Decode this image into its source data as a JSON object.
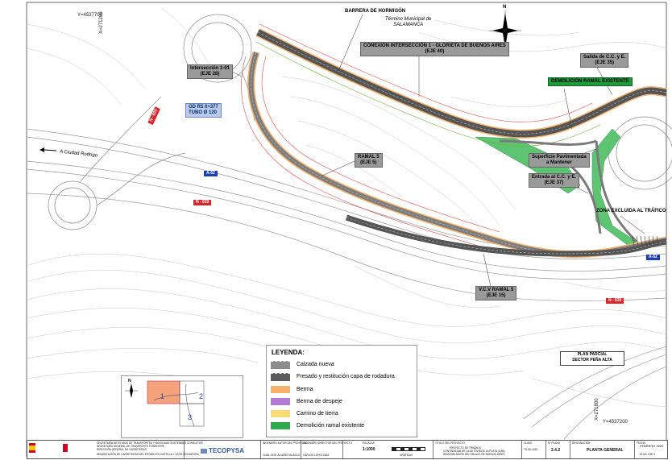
{
  "labels": {
    "barrera": "BARRERA DE HORMIGÓN",
    "termino_1": "Término Municipal de",
    "termino_2": "SALAMANCA",
    "conexion_1": "CONEXIÓN INTERSECCIÓN 1 - GLORIETA DE BUENOS AIRES",
    "conexion_2": "(EJE 40)",
    "salida_1": "Salida de C.C. y E.",
    "salida_2": "(EJE 35)",
    "demolicion": "DEMOLICIÓN RAMAL EXISTENTE",
    "interseccion_1": "Intersección 1-01",
    "interseccion_2": "(EJE 28)",
    "od_1": "OD R5 0+377",
    "od_2": "TUBO Ø 120",
    "ramal_1": "RAMAL 5",
    "ramal_2": "(EJE 5)",
    "superficie_1": "Superficie Pavimentada",
    "superficie_2": "a Mantener",
    "entrada_1": "Entrada al C.C. y E.",
    "entrada_2": "(EJE 37)",
    "zona": "ZONA EXCLUIDA AL TRÁFICO",
    "vcv_1": "V.C.V RAMAL 5",
    "vcv_2": "(EJE 15)",
    "ciudad": "A Ciudad Rodrigo",
    "plan_1": "PLAN PARCIAL",
    "plan_2": "SECTOR PEÑA ALTA",
    "north": "N"
  },
  "roads": {
    "n620_a": "N - 620",
    "n620_b": "N - 620",
    "n620_c": "N - 620",
    "a62_a": "A-62",
    "a62_b": "A-62"
  },
  "coords": {
    "y_top": "Y=4537700",
    "x_top": "X=271200",
    "y_bottom": "Y=4537200",
    "x_bottom": "X=271800"
  },
  "legend": {
    "title": "LEYENDA:",
    "items": [
      {
        "label": "Calzada nueva",
        "color": "#8c8c8c"
      },
      {
        "label": "Fresado y restitución capa de rodadura",
        "color": "#5a5a5a"
      },
      {
        "label": "Berma",
        "color": "#f6b26b"
      },
      {
        "label": "Berma de despeje",
        "color": "#b57bd6"
      },
      {
        "label": "Camino de tierra",
        "color": "#f7dc74"
      },
      {
        "label": "Demolición ramal existente",
        "color": "#2faa4f"
      }
    ]
  },
  "keymap": {
    "n1": "1",
    "n2": "2",
    "n3": "3",
    "north": "N"
  },
  "titleblock": {
    "ministry": "SECRETARÍA DE ESTADO DE TRANSPORTES Y MOVILIDAD SOSTENIBLE",
    "ministry_2": "SECRETARÍA GENERAL DE TRANSPORTE TERRESTRE",
    "ministry_3": "DIRECCIÓN GENERAL DE CARRETERAS",
    "ministry_4": "DEMARCACIÓN DE CARRETERAS DEL ESTADO EN CASTILLA Y LEÓN OCCIDENTAL",
    "consultor": "CONSULTOR",
    "company": "TECOPYSA",
    "autor": "INGENIERO AUTOR DEL PROYECTO",
    "autor_name": "JUAN JOSÉ ÁLVAREZ BLASCO",
    "director": "INGENIERO DIRECTOR DEL PROYECTO",
    "director_name": "CARLOS LÓPEZ DÍAZ",
    "escala_label": "ESCALAS",
    "escala": "1:1000",
    "graficas": "GRÁFICAS",
    "titulo_label": "TÍTULO DEL PROYECTO",
    "titulo_1": "PROYECTO DE TRAZADO",
    "titulo_2": "CONTINUIDAD DE LA AUTOVÍA DE LA PLATA (A-66)",
    "titulo_3": "REMODELACIÓN DEL ENLACE DE BUENOS AIRES",
    "clave_label": "CLAVE",
    "clave": "T5-SA-4410",
    "plano_label": "Nº PLANO",
    "plano": "2.4.2",
    "designacion_label": "DESIGNACIÓN",
    "designacion": "PLANTA GENERAL",
    "fecha_label": "FECHA",
    "fecha": "FEBRERO 2020",
    "hoja": "HOJA 1 DE 3"
  }
}
